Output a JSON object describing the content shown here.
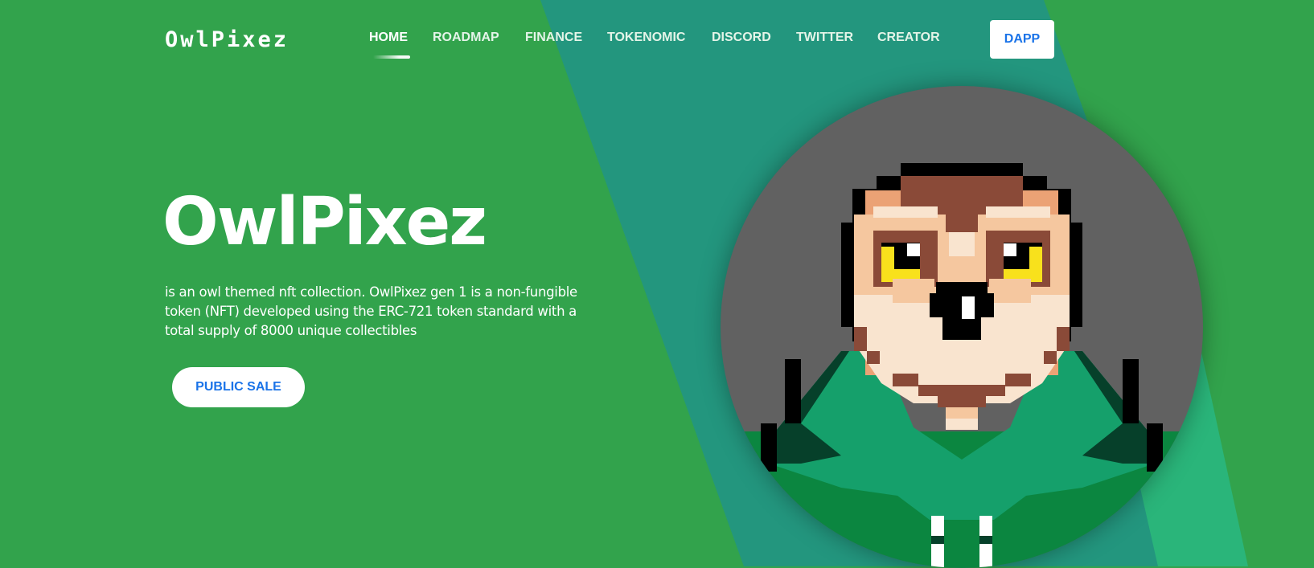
{
  "brand": {
    "logo_text": "OwlPixez"
  },
  "nav": {
    "items": [
      {
        "label": "HOME",
        "active": true
      },
      {
        "label": "ROADMAP",
        "active": false
      },
      {
        "label": "FINANCE",
        "active": false
      },
      {
        "label": "TOKENOMIC",
        "active": false
      },
      {
        "label": "DISCORD",
        "active": false
      },
      {
        "label": "TWITTER",
        "active": false
      },
      {
        "label": "CREATOR",
        "active": false
      }
    ],
    "dapp_label": "DAPP"
  },
  "hero": {
    "title": "OwlPixez",
    "description": "is an owl themed nft collection. OwlPixez gen 1 is a non-fungible token (NFT) developed using the ERC-721 token standard with a total supply of 8000 unique collectibles",
    "cta_label": "PUBLIC SALE"
  },
  "avatar": {
    "icon": "pixel-owl-icon"
  },
  "colors": {
    "background": "#32a34c",
    "teal_band": "#23967e",
    "teal_band_light": "#2ab57a",
    "avatar_circle": "#616161",
    "button_text": "#1a73e8",
    "owl_brown": "#8a4a38",
    "owl_eye": "#f8e11c",
    "owl_hoodie": "#15a06b"
  }
}
